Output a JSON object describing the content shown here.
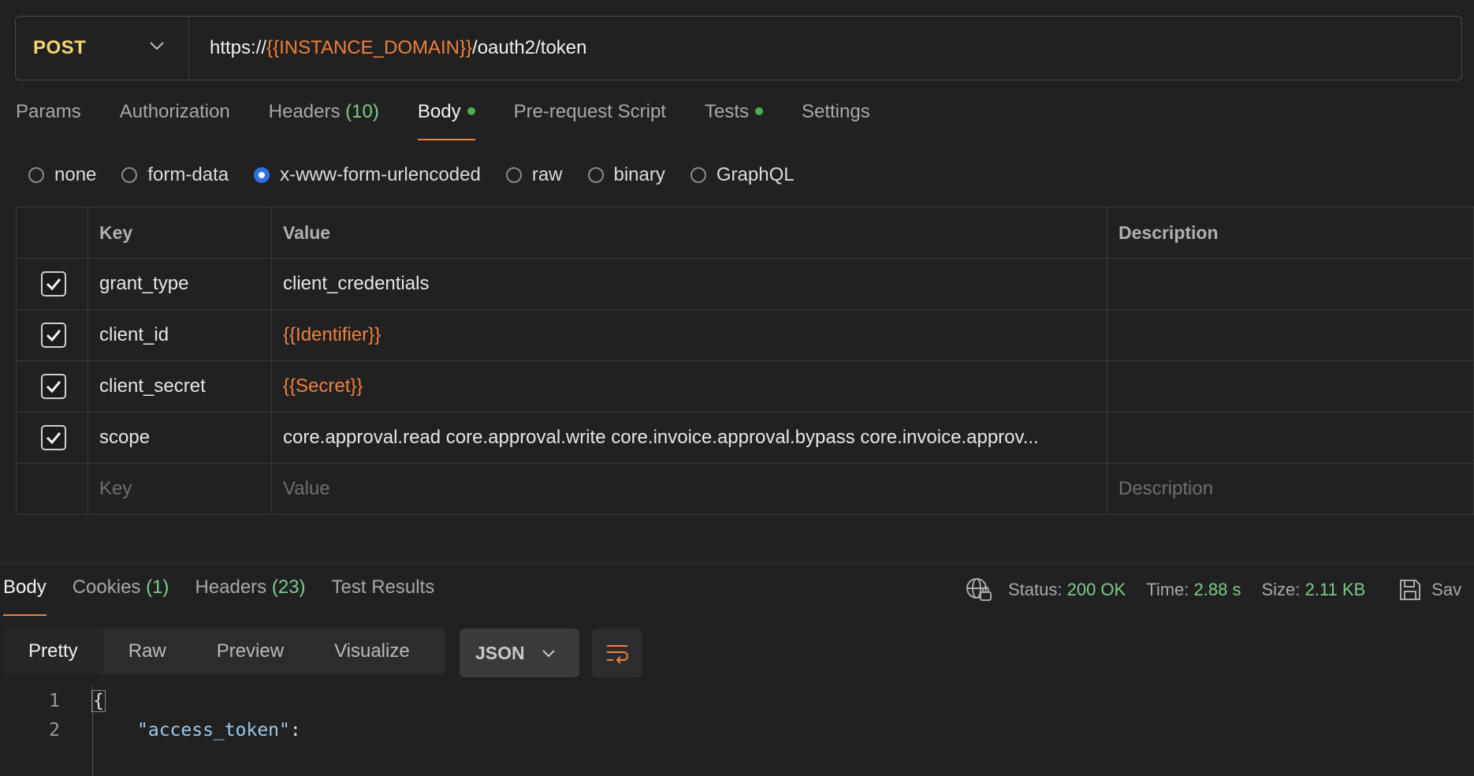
{
  "request": {
    "method": "POST",
    "url_prefix": "https://",
    "url_var": "{{INSTANCE_DOMAIN}}",
    "url_suffix": "/oauth2/token"
  },
  "request_tabs": [
    {
      "label": "Params"
    },
    {
      "label": "Authorization"
    },
    {
      "label": "Headers",
      "count": "(10)"
    },
    {
      "label": "Body",
      "active": true,
      "dot": true
    },
    {
      "label": "Pre-request Script"
    },
    {
      "label": "Tests",
      "dot": true
    },
    {
      "label": "Settings"
    }
  ],
  "body_types": [
    "none",
    "form-data",
    "x-www-form-urlencoded",
    "raw",
    "binary",
    "GraphQL"
  ],
  "body_type_selected": "x-www-form-urlencoded",
  "params_table": {
    "headers": {
      "key": "Key",
      "value": "Value",
      "description": "Description"
    },
    "rows": [
      {
        "checked": true,
        "key": "grant_type",
        "value": "client_credentials",
        "value_is_var": false,
        "description": ""
      },
      {
        "checked": true,
        "key": "client_id",
        "value": "{{Identifier}}",
        "value_is_var": true,
        "description": ""
      },
      {
        "checked": true,
        "key": "client_secret",
        "value": "{{Secret}}",
        "value_is_var": true,
        "description": ""
      },
      {
        "checked": true,
        "key": "scope",
        "value": "core.approval.read core.approval.write  core.invoice.approval.bypass core.invoice.approv...",
        "value_is_var": false,
        "description": ""
      }
    ],
    "placeholders": {
      "key": "Key",
      "value": "Value",
      "description": "Description"
    }
  },
  "response_tabs": [
    {
      "label": "Body",
      "active": true
    },
    {
      "label": "Cookies",
      "count": "(1)"
    },
    {
      "label": "Headers",
      "count": "(23)"
    },
    {
      "label": "Test Results"
    }
  ],
  "response_status": {
    "status_label": "Status:",
    "status_value": "200 OK",
    "time_label": "Time:",
    "time_value": "2.88 s",
    "size_label": "Size:",
    "size_value": "2.11 KB",
    "save_label": "Sav"
  },
  "view_modes": [
    "Pretty",
    "Raw",
    "Preview",
    "Visualize"
  ],
  "view_mode_selected": "Pretty",
  "format_select": "JSON",
  "code_lines": [
    {
      "num": "1",
      "text": "{"
    },
    {
      "num": "2",
      "text": "\"access_token\"",
      "suffix": ":"
    }
  ],
  "colors": {
    "accent": "#f0803c",
    "method": "#f5d76e",
    "success": "#7ecc8b",
    "radio_selected": "#2f6fe4",
    "background": "#212121"
  }
}
